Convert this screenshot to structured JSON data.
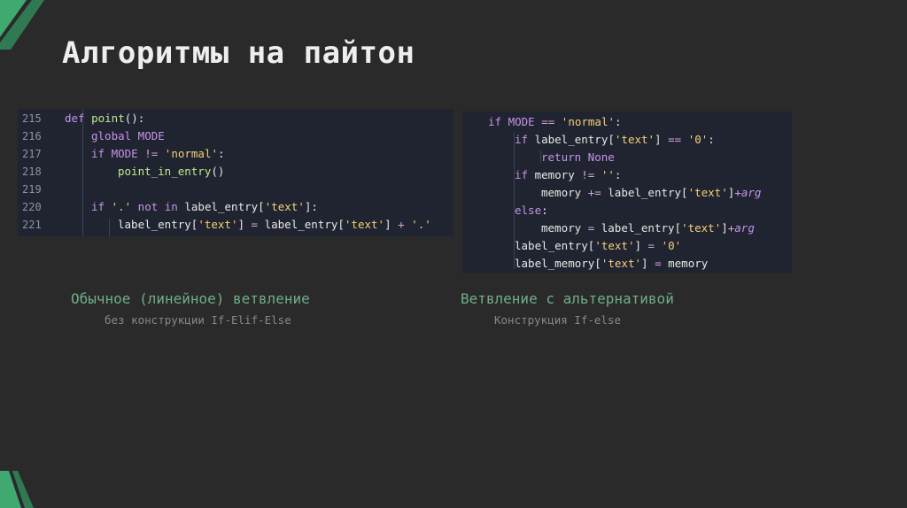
{
  "title": "Алгоритмы на пайтон",
  "left_code": {
    "lines": [
      {
        "num": "215",
        "tokens": [
          {
            "t": "def ",
            "c": "kw"
          },
          {
            "t": "point",
            "c": "fn"
          },
          {
            "t": "():",
            "c": "tx"
          }
        ]
      },
      {
        "num": "216",
        "tokens": [
          {
            "t": "global MODE",
            "c": "kw"
          }
        ]
      },
      {
        "num": "217",
        "tokens": [
          {
            "t": "if ",
            "c": "kw"
          },
          {
            "t": "MODE ",
            "c": "kw"
          },
          {
            "t": "!= ",
            "c": "op"
          },
          {
            "t": "'normal'",
            "c": "str"
          },
          {
            "t": ":",
            "c": "tx"
          }
        ]
      },
      {
        "num": "218",
        "tokens": [
          {
            "t": "point_in_entry",
            "c": "fn"
          },
          {
            "t": "()",
            "c": "tx"
          }
        ]
      },
      {
        "num": "219",
        "tokens": []
      },
      {
        "num": "220",
        "tokens": [
          {
            "t": "if ",
            "c": "kw"
          },
          {
            "t": "'.'",
            "c": "str"
          },
          {
            "t": " not in ",
            "c": "kw"
          },
          {
            "t": "label_entry[",
            "c": "tx"
          },
          {
            "t": "'text'",
            "c": "str"
          },
          {
            "t": "]:",
            "c": "tx"
          }
        ]
      },
      {
        "num": "221",
        "tokens": [
          {
            "t": "label_entry[",
            "c": "tx"
          },
          {
            "t": "'text'",
            "c": "str"
          },
          {
            "t": "] ",
            "c": "tx"
          },
          {
            "t": "= ",
            "c": "op"
          },
          {
            "t": "label_entry[",
            "c": "tx"
          },
          {
            "t": "'text'",
            "c": "str"
          },
          {
            "t": "] ",
            "c": "tx"
          },
          {
            "t": "+ ",
            "c": "op"
          },
          {
            "t": "'.'",
            "c": "str"
          }
        ]
      }
    ]
  },
  "right_code": {
    "lines": [
      {
        "tokens": [
          {
            "t": "if ",
            "c": "kw"
          },
          {
            "t": "MODE ",
            "c": "kw"
          },
          {
            "t": "== ",
            "c": "op"
          },
          {
            "t": "'normal'",
            "c": "str"
          },
          {
            "t": ":",
            "c": "tx"
          }
        ]
      },
      {
        "tokens": [
          {
            "t": "if ",
            "c": "kw"
          },
          {
            "t": "label_entry[",
            "c": "tx"
          },
          {
            "t": "'text'",
            "c": "str"
          },
          {
            "t": "] ",
            "c": "tx"
          },
          {
            "t": "== ",
            "c": "op"
          },
          {
            "t": "'0'",
            "c": "str"
          },
          {
            "t": ":",
            "c": "tx"
          }
        ]
      },
      {
        "tokens": [
          {
            "t": "return None",
            "c": "kw"
          }
        ]
      },
      {
        "tokens": [
          {
            "t": "if ",
            "c": "kw"
          },
          {
            "t": "memory ",
            "c": "tx"
          },
          {
            "t": "!= ",
            "c": "op"
          },
          {
            "t": "''",
            "c": "str"
          },
          {
            "t": ":",
            "c": "tx"
          }
        ]
      },
      {
        "tokens": [
          {
            "t": "memory ",
            "c": "tx"
          },
          {
            "t": "+= ",
            "c": "op"
          },
          {
            "t": "label_entry[",
            "c": "tx"
          },
          {
            "t": "'text'",
            "c": "str"
          },
          {
            "t": "]",
            "c": "tx"
          },
          {
            "t": "+",
            "c": "op"
          },
          {
            "t": "arg",
            "c": "it"
          }
        ]
      },
      {
        "tokens": [
          {
            "t": "else",
            "c": "kw"
          },
          {
            "t": ":",
            "c": "tx"
          }
        ]
      },
      {
        "tokens": [
          {
            "t": "memory ",
            "c": "tx"
          },
          {
            "t": "= ",
            "c": "op"
          },
          {
            "t": "label_entry[",
            "c": "tx"
          },
          {
            "t": "'text'",
            "c": "str"
          },
          {
            "t": "]",
            "c": "tx"
          },
          {
            "t": "+",
            "c": "op"
          },
          {
            "t": "arg",
            "c": "it"
          }
        ]
      },
      {
        "tokens": [
          {
            "t": "label_entry[",
            "c": "tx"
          },
          {
            "t": "'text'",
            "c": "str"
          },
          {
            "t": "] ",
            "c": "tx"
          },
          {
            "t": "= ",
            "c": "op"
          },
          {
            "t": "'0'",
            "c": "str"
          }
        ]
      },
      {
        "tokens": [
          {
            "t": "label_memory[",
            "c": "tx"
          },
          {
            "t": "'text'",
            "c": "str"
          },
          {
            "t": "] ",
            "c": "tx"
          },
          {
            "t": "= ",
            "c": "op"
          },
          {
            "t": "memory",
            "c": "tx"
          }
        ]
      }
    ]
  },
  "captions": {
    "left_main": "Обычное (линейное) ветвление",
    "left_sub": "без конструкции If-Elif-Else",
    "right_main": "Ветвление с альтернативой",
    "right_sub": "Конструкция If-else"
  },
  "colors": {
    "background": "#2a2a2a",
    "accent_green": "#3fa96f",
    "code_bg": "#1f2430"
  }
}
